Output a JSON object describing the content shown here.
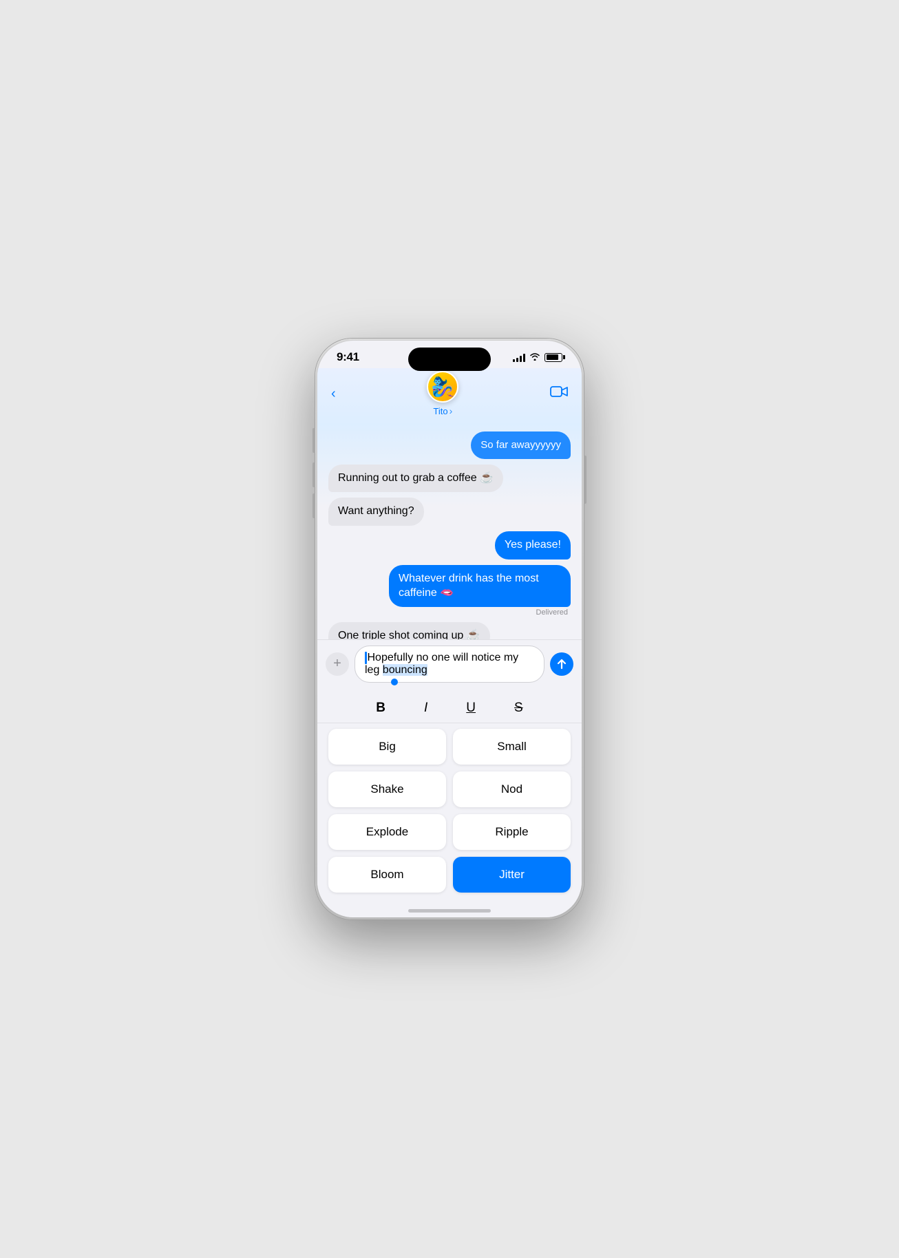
{
  "status": {
    "time": "9:41"
  },
  "contact": {
    "name": "Tito",
    "chevron": "›",
    "avatar_emoji": "🧞‍♀️"
  },
  "messages": [
    {
      "type": "sent",
      "text": "So far awayyyyyy",
      "truncated": true
    },
    {
      "type": "received",
      "text": "Running out to grab a coffee ☕"
    },
    {
      "type": "received",
      "text": "Want anything?"
    },
    {
      "type": "sent",
      "text": "Yes please!"
    },
    {
      "type": "sent",
      "text": "Whatever drink has the most caffeine 🫦",
      "delivered": true,
      "delivered_label": "Delivered"
    },
    {
      "type": "received",
      "text": "One triple shot coming up ☕"
    }
  ],
  "input": {
    "text_before": "Hopefully no one will notice my leg ",
    "text_selected": "bouncing",
    "add_button_label": "+",
    "send_button_label": "↑"
  },
  "format_buttons": [
    {
      "label": "B",
      "style": "bold"
    },
    {
      "label": "I",
      "style": "italic"
    },
    {
      "label": "U",
      "style": "underline"
    },
    {
      "label": "S",
      "style": "strikethrough"
    }
  ],
  "effect_buttons": [
    {
      "label": "Big",
      "active": false
    },
    {
      "label": "Small",
      "active": false
    },
    {
      "label": "Shake",
      "active": false
    },
    {
      "label": "Nod",
      "active": false
    },
    {
      "label": "Explode",
      "active": false
    },
    {
      "label": "Ripple",
      "active": false
    },
    {
      "label": "Bloom",
      "active": false
    },
    {
      "label": "Jitter",
      "active": true
    }
  ],
  "nav": {
    "back_label": "‹",
    "video_icon": "📹"
  }
}
